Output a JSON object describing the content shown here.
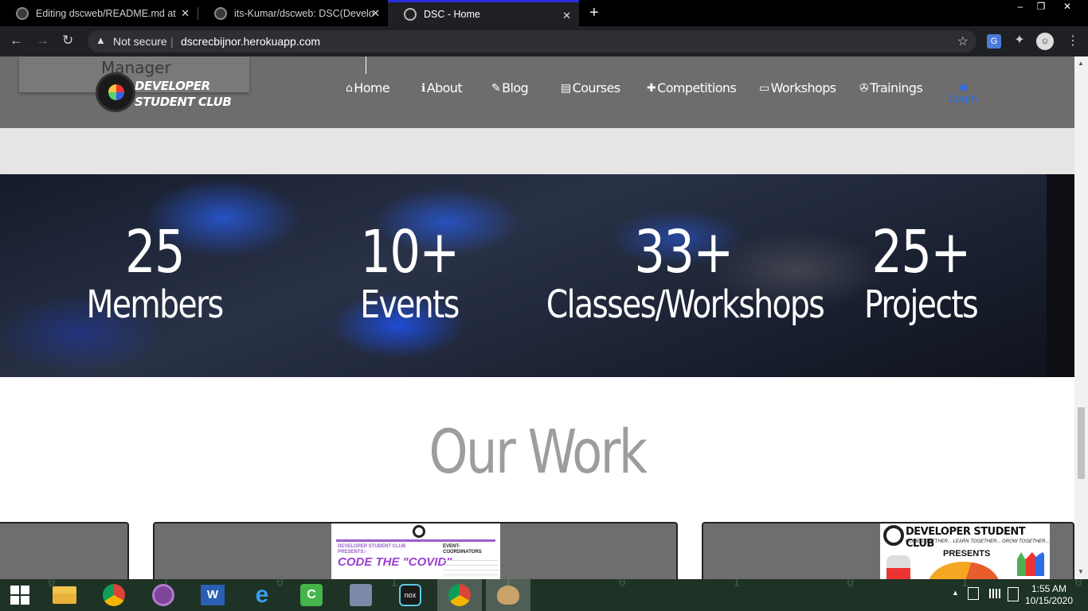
{
  "browser": {
    "tabs": [
      {
        "title": "Editing dscweb/README.md at m",
        "close": "✕",
        "icon": "github-icon"
      },
      {
        "title": "its-Kumar/dscweb: DSC(Develope",
        "close": "✕",
        "icon": "github-icon"
      },
      {
        "title": "DSC - Home",
        "close": "✕",
        "icon": "dsc-icon",
        "active": true
      }
    ],
    "new_tab": "+",
    "window_controls": {
      "minimize": "–",
      "restore": "❐",
      "close": "✕"
    },
    "nav": {
      "back": "←",
      "forward": "→",
      "reload": "↻"
    },
    "omnibox": {
      "security_icon": "▲",
      "security_text": "Not secure",
      "separator": "|",
      "url": "dscrecbijnor.herokuapp.com",
      "bookmark": "☆"
    },
    "extensions": {
      "translate": "G",
      "puzzle": "✦",
      "profile": "☺",
      "menu": "⋮"
    }
  },
  "site": {
    "manager_text": "Manager",
    "logo": {
      "line1": "DEVELOPER",
      "line2": "STUDENT CLUB"
    },
    "nav": [
      {
        "label": "Home",
        "icon": "⌂"
      },
      {
        "label": "About",
        "icon": "ℹ"
      },
      {
        "label": "Blog",
        "icon": "✎"
      },
      {
        "label": "Courses",
        "icon": "▤"
      },
      {
        "label": "Competitions",
        "icon": "✚"
      },
      {
        "label": "Workshops",
        "icon": "▭"
      },
      {
        "label": "Trainings",
        "icon": "✇"
      }
    ],
    "login": {
      "icon": "●",
      "label": "Login"
    },
    "stats": [
      {
        "number": "25",
        "label": "Members"
      },
      {
        "number": "10+",
        "label": "Events"
      },
      {
        "number": "33+",
        "label": "Classes/Workshops"
      },
      {
        "number": "25+",
        "label": "Projects"
      }
    ],
    "our_work_title": "Our Work",
    "poster1": {
      "brand": "DEVELOPER STUDENT CLUB",
      "presents": "PRESENTS:-",
      "coordinators": "EVENT-",
      "coordinators2": "COORDINATORS",
      "title": "CODE THE \"COVID\""
    },
    "poster2": {
      "brand": "DEVELOPER STUDENT CLUB",
      "tagline": "COME TOGETHER... LEARN TOGETHER... GROW TOGETHER...",
      "presents": "PRESENTS"
    }
  },
  "taskbar": {
    "background_digits": "0 1 0 1 1 0 1 0 1 0 0 1 0 1 0 1",
    "apps": [
      "start-icon",
      "file-explorer-icon",
      "chrome-icon",
      "tor-icon",
      "word-icon",
      "edge-icon",
      "camtasia-icon",
      "vlc-icon",
      "nox-icon",
      "chrome-active-icon",
      "paint-icon"
    ],
    "tray": {
      "chevron": "▲",
      "time": "1:55 AM",
      "date": "10/15/2020"
    }
  }
}
